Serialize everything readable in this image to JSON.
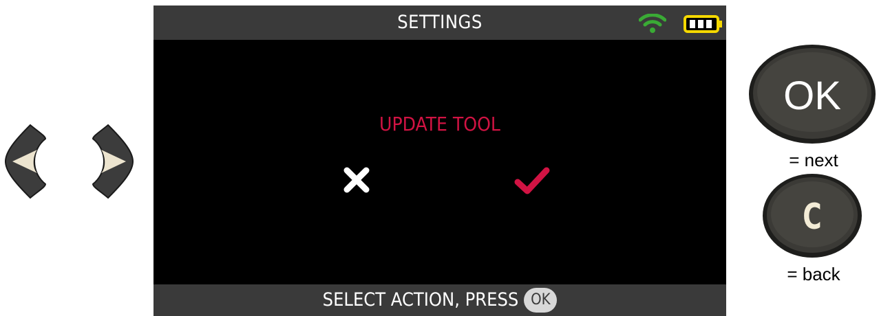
{
  "screen": {
    "title": "SETTINGS",
    "status_icons": [
      "wifi-icon",
      "battery-icon"
    ],
    "prompt": "UPDATE TOOL",
    "options": [
      {
        "icon": "cross-icon",
        "meaning": "cancel",
        "color": "#ffffff"
      },
      {
        "icon": "checkmark-icon",
        "meaning": "confirm",
        "color": "#d11343"
      }
    ],
    "hint": "SELECT ACTION, PRESS",
    "hint_key": "OK"
  },
  "keys": {
    "ok_label": "OK",
    "ok_legend": "= next",
    "c_label": "C",
    "c_legend": "= back",
    "arrows": [
      "arrow-left-icon",
      "arrow-right-icon"
    ]
  },
  "colors": {
    "bar": "#3a3a3a",
    "screen_bg": "#000000",
    "accent": "#d11343",
    "wifi": "#3aaa35",
    "battery": "#f5d800"
  }
}
